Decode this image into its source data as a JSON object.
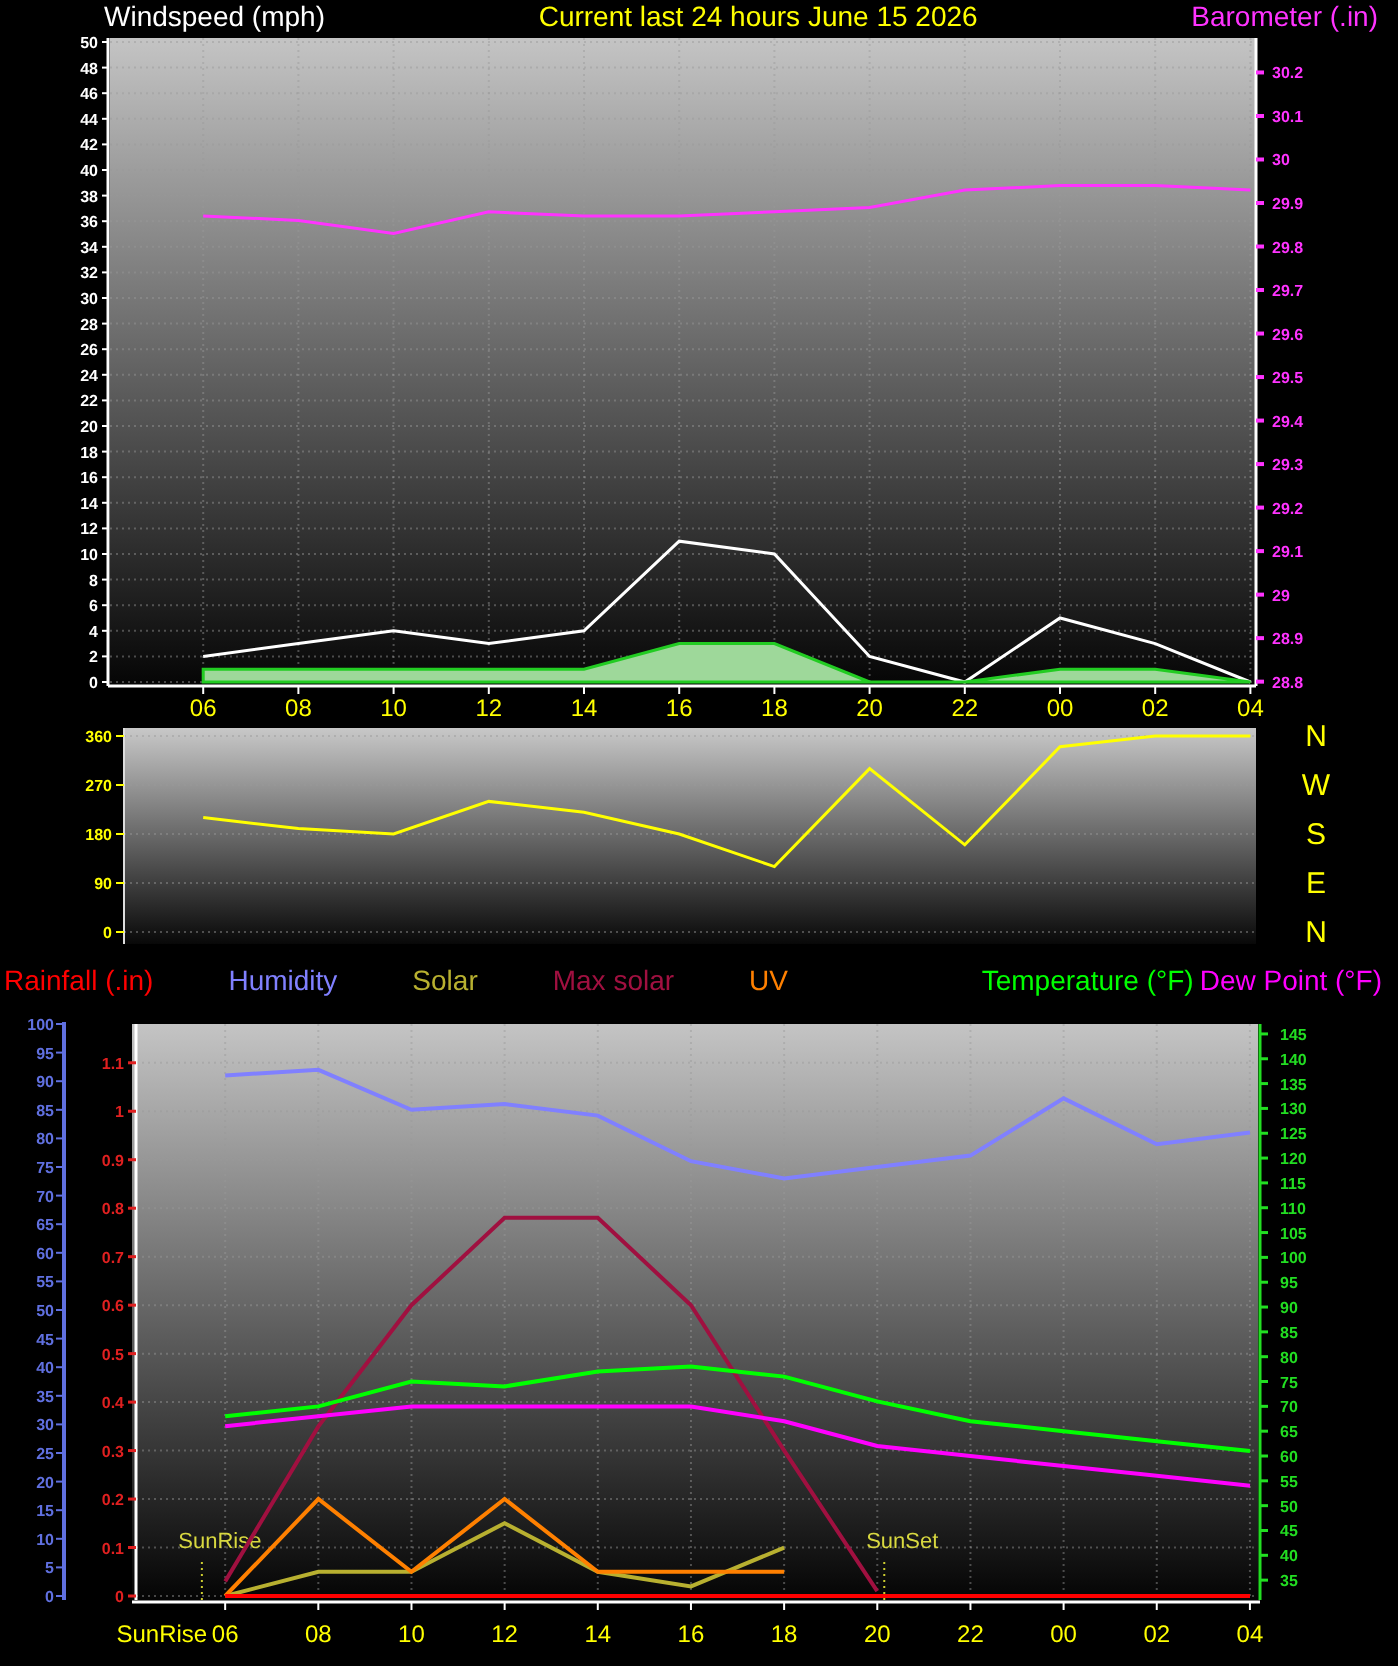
{
  "wind_panel": {
    "chart_data": {
      "type": "line",
      "grid": true,
      "title": "Current last 24 hours June 15 2026",
      "ylabel": "Windspeed (mph)",
      "y2label": "Barometer (.in)",
      "categories": [
        "06",
        "08",
        "10",
        "12",
        "14",
        "16",
        "18",
        "20",
        "22",
        "00",
        "02",
        "04"
      ],
      "ylim": [
        0,
        50
      ],
      "yticks": [
        0,
        2,
        4,
        6,
        8,
        10,
        12,
        14,
        16,
        18,
        20,
        22,
        24,
        26,
        28,
        30,
        32,
        34,
        36,
        38,
        40,
        42,
        44,
        46,
        48,
        50
      ],
      "y2lim": [
        28.79,
        30.27
      ],
      "y2ticks": [
        28.8,
        28.9,
        29,
        29.1,
        29.2,
        29.3,
        29.4,
        29.5,
        29.6,
        29.7,
        29.8,
        29.9,
        30,
        30.1,
        30.2
      ],
      "series": [
        {
          "color": "#ff33ff",
          "axis": "y2",
          "values": [
            29.87,
            29.86,
            29.83,
            29.88,
            29.87,
            29.87,
            29.88,
            29.89,
            29.93,
            29.94,
            29.94,
            29.93
          ]
        },
        {
          "color": "#ffffff",
          "values": [
            2,
            3,
            4,
            3,
            4,
            11,
            10,
            2,
            0,
            5,
            3,
            0
          ]
        },
        {
          "color": "#22cc22",
          "type": "area",
          "values": [
            1,
            1,
            1,
            1,
            1,
            3,
            3,
            0,
            0,
            1,
            1,
            0
          ]
        }
      ]
    }
  },
  "direction_panel": {
    "chart_data": {
      "type": "line",
      "ylim": [
        0,
        360
      ],
      "yticks": [
        0,
        90,
        180,
        270,
        360
      ],
      "series": [
        {
          "color": "#ffff00",
          "values": [
            210,
            190,
            180,
            240,
            220,
            180,
            120,
            300,
            160,
            340,
            360,
            360
          ]
        }
      ]
    },
    "compass_labels": [
      "N",
      "W",
      "S",
      "E",
      "N"
    ]
  },
  "weather_panel": {
    "chart_data": {
      "type": "line",
      "grid": true,
      "categories": [
        "06",
        "08",
        "10",
        "12",
        "14",
        "16",
        "18",
        "20",
        "22",
        "00",
        "02",
        "04"
      ],
      "ylim": [
        0,
        100
      ],
      "yticks": [
        0,
        5,
        10,
        15,
        20,
        25,
        30,
        35,
        40,
        45,
        50,
        55,
        60,
        65,
        70,
        75,
        80,
        85,
        90,
        95,
        100
      ],
      "y2lim": [
        0,
        1.18
      ],
      "y2ticks": [
        0,
        0.1,
        0.2,
        0.3,
        0.4,
        0.5,
        0.6,
        0.7,
        0.8,
        0.9,
        1,
        1.1
      ],
      "y3lim": [
        31,
        147
      ],
      "y3ticks": [
        35,
        40,
        45,
        50,
        55,
        60,
        65,
        70,
        75,
        80,
        85,
        90,
        95,
        100,
        105,
        110,
        115,
        120,
        125,
        130,
        135,
        140,
        145
      ],
      "series": [
        {
          "name": "Rainfall (.in)",
          "color": "#ff0000",
          "axis": "y2",
          "values": [
            0,
            0,
            0,
            0,
            0,
            0,
            0,
            0,
            0,
            0,
            0,
            0
          ]
        },
        {
          "name": "Humidity",
          "color": "#8080ff",
          "values": [
            91,
            92,
            85,
            86,
            84,
            76,
            73,
            75,
            77,
            87,
            79,
            81
          ]
        },
        {
          "name": "Solar",
          "color": "#b8b030",
          "axis": "y2",
          "values": [
            0,
            0.05,
            0.05,
            0.15,
            0.05,
            0.02,
            0.1,
            null,
            null,
            null,
            null,
            null
          ]
        },
        {
          "name": "Max solar",
          "color": "#a01040",
          "axis": "y2",
          "values": [
            0.03,
            0.35,
            0.6,
            0.78,
            0.78,
            0.6,
            0.3,
            0.01,
            null,
            null,
            null,
            null
          ]
        },
        {
          "name": "UV",
          "color": "#ff8000",
          "axis": "y2",
          "values": [
            0,
            0.2,
            0.05,
            0.2,
            0.05,
            0.05,
            0.05,
            null,
            null,
            null,
            null,
            null
          ]
        },
        {
          "name": "Temperature (°F)",
          "color": "#00ff00",
          "axis": "y3",
          "values": [
            68,
            70,
            75,
            74,
            77,
            78,
            76,
            71,
            67,
            65,
            63,
            61
          ]
        },
        {
          "name": "Dew Point (°F)",
          "color": "#ff00ff",
          "axis": "y3",
          "values": [
            66,
            68,
            70,
            70,
            70,
            70,
            67,
            62,
            60,
            58,
            56,
            54
          ]
        }
      ]
    },
    "sun_markers": [
      {
        "kind": "sunrise",
        "label": "SunRise"
      },
      {
        "kind": "sunset",
        "label": "SunSet"
      },
      {
        "kind": "sunrise_axis",
        "label": "SunRise"
      }
    ]
  }
}
